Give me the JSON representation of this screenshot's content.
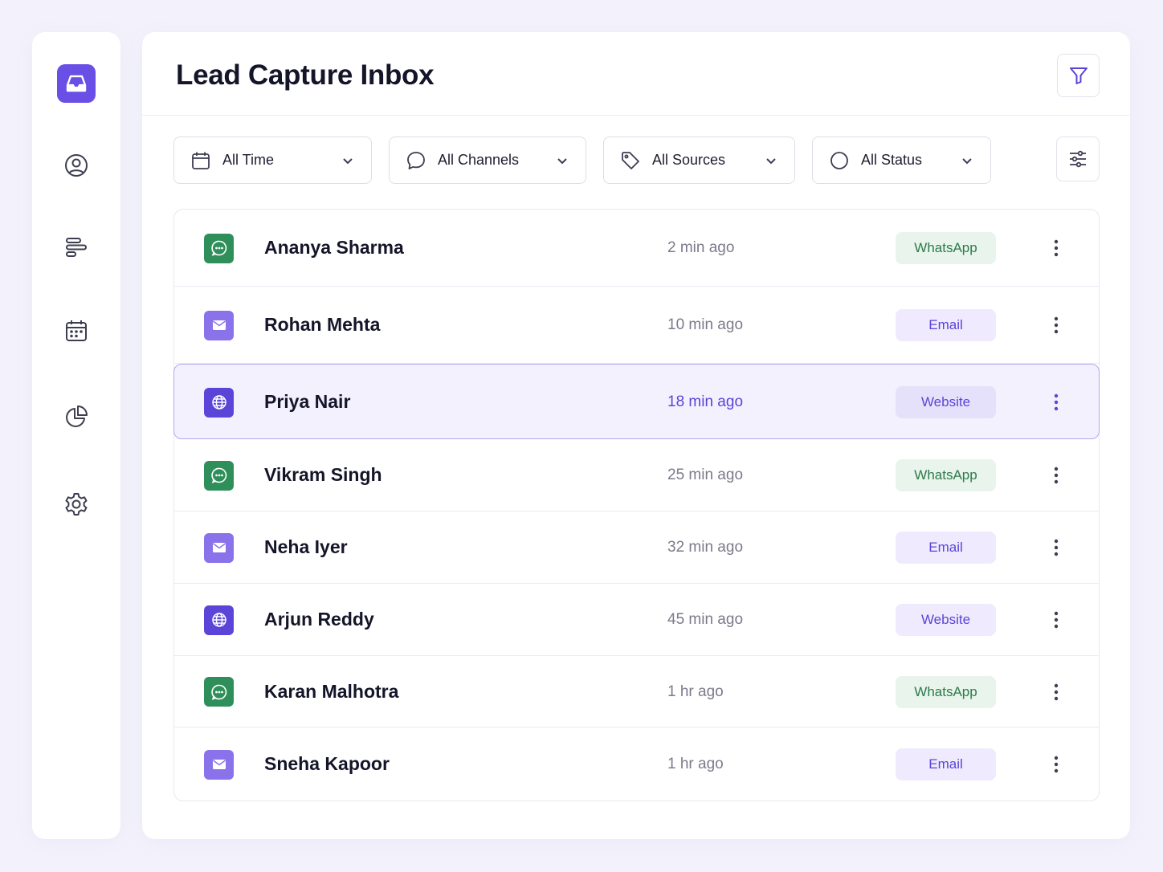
{
  "sidebar": {
    "items": [
      {
        "id": "inbox",
        "icon": "inbox-icon",
        "active": true
      },
      {
        "id": "contacts",
        "icon": "user-circle-icon",
        "active": false
      },
      {
        "id": "pipeline",
        "icon": "bars-layout-icon",
        "active": false
      },
      {
        "id": "calendar",
        "icon": "calendar-icon",
        "active": false
      },
      {
        "id": "reports",
        "icon": "pie-chart-icon",
        "active": false
      },
      {
        "id": "settings",
        "icon": "gear-icon",
        "active": false
      }
    ]
  },
  "header": {
    "title": "Lead Capture Inbox",
    "filter_icon": "funnel-icon"
  },
  "filters": [
    {
      "label": "All Time",
      "icon": "calendar-icon"
    },
    {
      "label": "All Channels",
      "icon": "chat-bubble-icon"
    },
    {
      "label": "All Sources",
      "icon": "tag-icon"
    },
    {
      "label": "All Status",
      "icon": "circle-icon"
    }
  ],
  "adjust_icon": "sliders-icon",
  "leads": [
    {
      "name": "Ananya Sharma",
      "time": "2 min ago",
      "channel": "WhatsApp",
      "type": "whatsapp"
    },
    {
      "name": "Rohan Mehta",
      "time": "10 min ago",
      "channel": "Email",
      "type": "email"
    },
    {
      "name": "Priya Nair",
      "time": "18 min ago",
      "channel": "Website",
      "type": "website",
      "selected": true
    },
    {
      "name": "Vikram Singh",
      "time": "25 min ago",
      "channel": "WhatsApp",
      "type": "whatsapp"
    },
    {
      "name": "Neha Iyer",
      "time": "32 min ago",
      "channel": "Email",
      "type": "email"
    },
    {
      "name": "Arjun Reddy",
      "time": "45 min ago",
      "channel": "Website",
      "type": "website"
    },
    {
      "name": "Karan Malhotra",
      "time": "1 hr ago",
      "channel": "WhatsApp",
      "type": "whatsapp"
    },
    {
      "name": "Sneha Kapoor",
      "time": "1 hr ago",
      "channel": "Email",
      "type": "email"
    }
  ],
  "colors": {
    "accent": "#6a4fe6",
    "whatsapp": "#2f8f5b",
    "email": "#8a72ea",
    "website": "#5b45d9",
    "background": "#f3f2fc"
  }
}
